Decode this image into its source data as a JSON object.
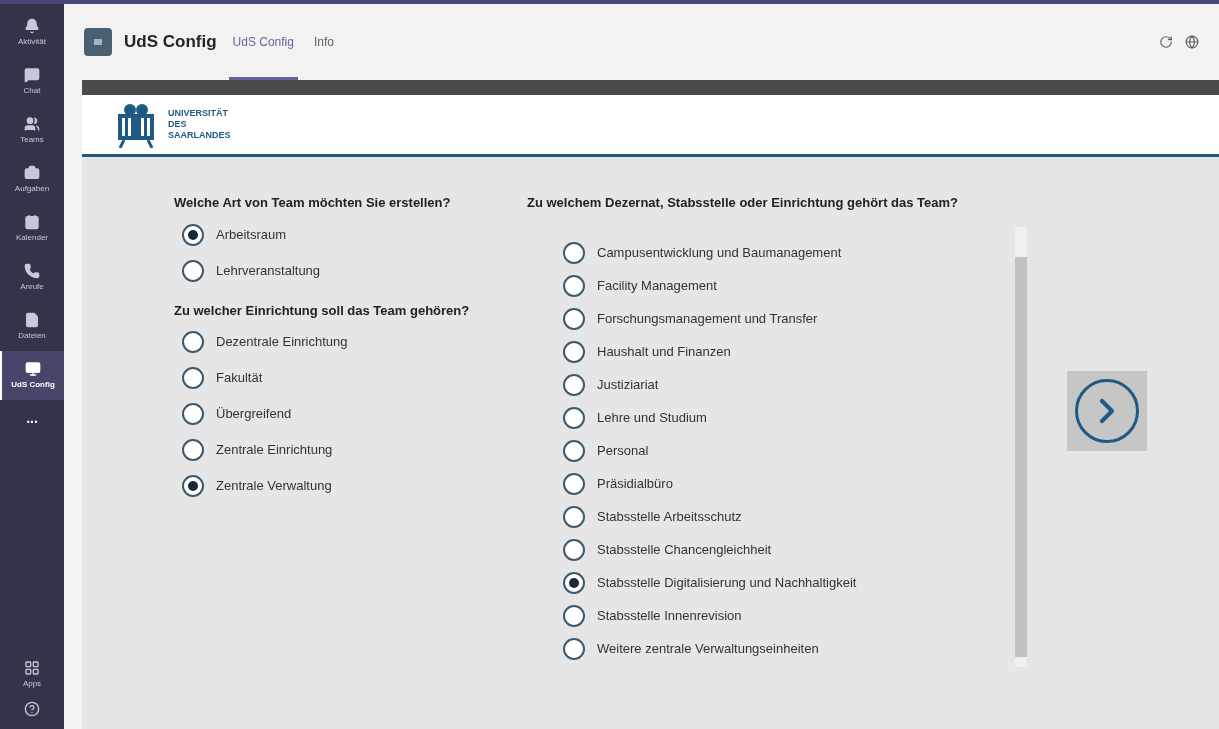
{
  "sidebar": {
    "items": [
      {
        "label": "Aktivität",
        "selected": false
      },
      {
        "label": "Chat",
        "selected": false
      },
      {
        "label": "Teams",
        "selected": false
      },
      {
        "label": "Aufgaben",
        "selected": false
      },
      {
        "label": "Kalender",
        "selected": false
      },
      {
        "label": "Anrufe",
        "selected": false
      },
      {
        "label": "Dateien",
        "selected": false
      },
      {
        "label": "UdS Config",
        "selected": true
      }
    ],
    "more": "...",
    "bottom": [
      {
        "label": "Apps"
      }
    ]
  },
  "header": {
    "title": "UdS Config",
    "tabs": [
      {
        "label": "UdS Config",
        "selected": true
      },
      {
        "label": "Info",
        "selected": false
      }
    ]
  },
  "logo": {
    "lines": [
      "UNIVERSITÄT",
      "DES",
      "SAARLANDES"
    ]
  },
  "questions": [
    {
      "title": "Welche Art von Team möchten Sie erstellen?",
      "options": [
        {
          "label": "Arbeitsraum",
          "selected": true
        },
        {
          "label": "Lehrveranstaltung",
          "selected": false
        }
      ]
    },
    {
      "title": "Zu welcher Einrichtung soll das Team gehören?",
      "options": [
        {
          "label": "Dezentrale Einrichtung",
          "selected": false
        },
        {
          "label": "Fakultät",
          "selected": false
        },
        {
          "label": "Übergreifend",
          "selected": false
        },
        {
          "label": "Zentrale Einrichtung",
          "selected": false
        },
        {
          "label": "Zentrale Verwaltung",
          "selected": true
        }
      ]
    }
  ],
  "department": {
    "title": "Zu welchem Dezernat, Stabsstelle oder Einrichtung gehört das Team?",
    "options": [
      {
        "label": "Campusentwicklung und Baumanagement",
        "selected": false
      },
      {
        "label": "Facility Management",
        "selected": false
      },
      {
        "label": "Forschungsmanagement und Transfer",
        "selected": false
      },
      {
        "label": "Haushalt und Finanzen",
        "selected": false
      },
      {
        "label": "Justiziariat",
        "selected": false
      },
      {
        "label": "Lehre und Studium",
        "selected": false
      },
      {
        "label": "Personal",
        "selected": false
      },
      {
        "label": "Präsidialbüro",
        "selected": false
      },
      {
        "label": "Stabsstelle Arbeitsschutz",
        "selected": false
      },
      {
        "label": "Stabsstelle Chancengleichheit",
        "selected": false
      },
      {
        "label": "Stabsstelle Digitalisierung und Nachhaltigkeit",
        "selected": true
      },
      {
        "label": "Stabsstelle Innenrevision",
        "selected": false
      },
      {
        "label": "Weitere zentrale Verwaltungseinheiten",
        "selected": false
      }
    ]
  }
}
